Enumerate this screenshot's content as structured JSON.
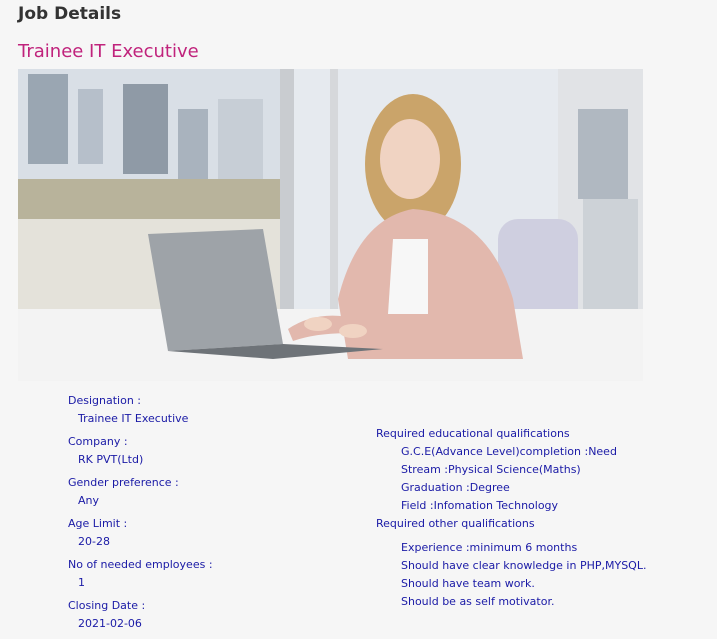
{
  "header": {
    "title": "Job Details"
  },
  "job": {
    "title": "Trainee IT Executive",
    "image_description_icon": "photo-of-woman-working-on-laptop"
  },
  "details": {
    "designation_label": "Designation :",
    "designation_value": "Trainee IT Executive",
    "company_label": "Company :",
    "company_value": "RK PVT(Ltd)",
    "gender_label": "Gender preference :",
    "gender_value": "Any",
    "age_label": "Age Limit :",
    "age_value": "20-28",
    "employees_label": "No of needed employees :",
    "employees_value": "1",
    "closing_label": "Closing Date :",
    "closing_value": "2021-02-06"
  },
  "qualifications": {
    "educational_title": "Required educational qualifications",
    "educational_items": [
      "G.C.E(Advance Level)completion :Need",
      "Stream :Physical Science(Maths)",
      "Graduation :Degree",
      "Field :Infomation Technology"
    ],
    "other_title": "Required other qualifications",
    "other_items": [
      "Experience :minimum 6 months",
      "Should have clear knowledge in PHP,MYSQL.",
      "Should have team work.",
      "Should be as self motivator."
    ]
  },
  "colors": {
    "title_accent": "#c0237c",
    "text_blue": "#1a1aa6",
    "heading": "#333333"
  }
}
